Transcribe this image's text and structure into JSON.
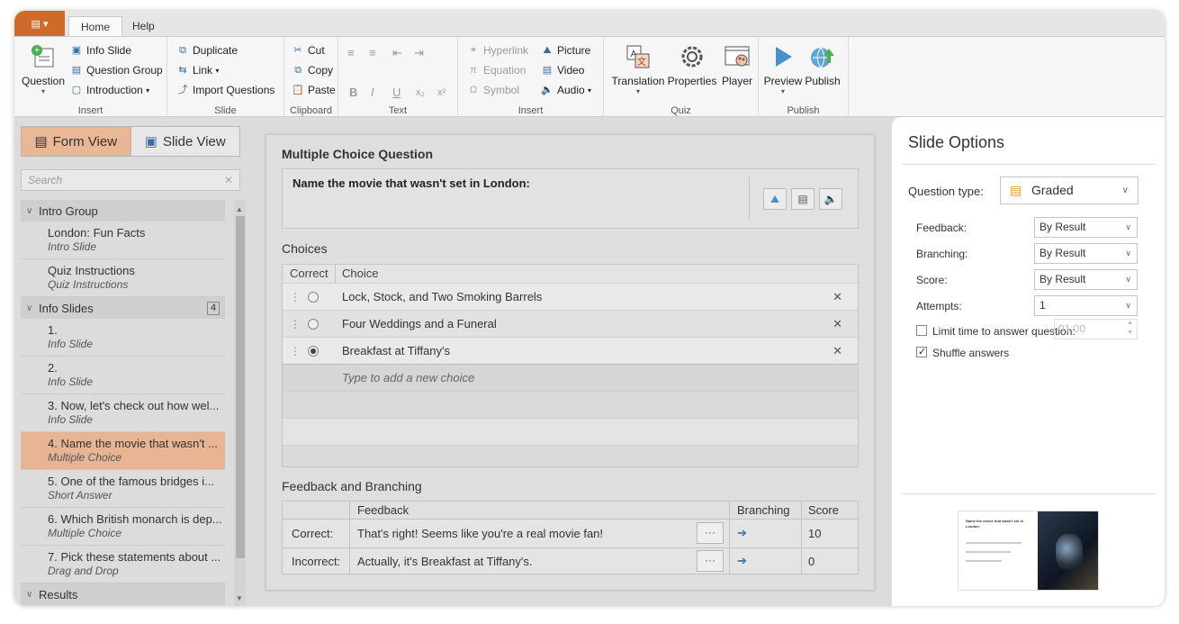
{
  "ribbon": {
    "tabs": [
      "Home",
      "Help"
    ],
    "groups": {
      "insert": {
        "label": "Insert",
        "question": "Question",
        "info_slide": "Info Slide",
        "question_group": "Question Group",
        "introduction": "Introduction"
      },
      "slide": {
        "label": "Slide",
        "duplicate": "Duplicate",
        "link": "Link",
        "import_questions": "Import Questions"
      },
      "clipboard": {
        "label": "Clipboard",
        "cut": "Cut",
        "copy": "Copy",
        "paste": "Paste"
      },
      "text": {
        "label": "Text",
        "bold": "B",
        "italic": "I",
        "underline": "U",
        "subscript": "x₂",
        "superscript": "x²"
      },
      "insert2": {
        "label": "Insert",
        "hyperlink": "Hyperlink",
        "equation": "Equation",
        "symbol": "Symbol",
        "picture": "Picture",
        "video": "Video",
        "audio": "Audio"
      },
      "quiz": {
        "label": "Quiz",
        "translation": "Translation",
        "properties": "Properties",
        "player": "Player"
      },
      "publish": {
        "label": "Publish",
        "preview": "Preview",
        "publish": "Publish"
      }
    }
  },
  "left": {
    "form_view": "Form View",
    "slide_view": "Slide View",
    "search_placeholder": "Search",
    "groups": [
      {
        "name": "Intro Group",
        "items": [
          {
            "title": "London: Fun Facts",
            "sub": "Intro Slide"
          },
          {
            "title": "Quiz Instructions",
            "sub": "Quiz Instructions"
          }
        ]
      },
      {
        "name": "Info Slides",
        "count": "4",
        "items": [
          {
            "title": "1.",
            "sub": "Info Slide"
          },
          {
            "title": "2.",
            "sub": "Info Slide"
          },
          {
            "title": "3. Now, let's check out how wel...",
            "sub": "Info Slide"
          },
          {
            "title": "4. Name the movie that wasn't ...",
            "sub": "Multiple Choice",
            "selected": true
          },
          {
            "title": "5. One of the famous bridges i...",
            "sub": "Short Answer"
          },
          {
            "title": "6. Which British monarch is dep...",
            "sub": "Multiple Choice"
          },
          {
            "title": "7. Pick these statements about ...",
            "sub": "Drag and Drop"
          }
        ]
      },
      {
        "name": "Results"
      }
    ]
  },
  "center": {
    "question_header": "Multiple Choice Question",
    "question_text": "Name the movie that wasn't set in London:",
    "choices_header": "Choices",
    "col_correct": "Correct",
    "col_choice": "Choice",
    "choices": [
      {
        "text": "Lock, Stock, and Two Smoking Barrels",
        "correct": false
      },
      {
        "text": "Four Weddings and a Funeral",
        "correct": false
      },
      {
        "text": "Breakfast at Tiffany's",
        "correct": true
      }
    ],
    "new_choice_placeholder": "Type to add a new choice",
    "feedback_header": "Feedback and Branching",
    "fb_col_feedback": "Feedback",
    "fb_col_branching": "Branching",
    "fb_col_score": "Score",
    "feedback": [
      {
        "label": "Correct:",
        "text": "That's right! Seems like you're a real movie fan!",
        "score": "10"
      },
      {
        "label": "Incorrect:",
        "text": "Actually, it's Breakfast at Tiffany's.",
        "score": "0"
      }
    ],
    "dots": "···",
    "branch_arrow": "➔"
  },
  "right": {
    "title": "Slide Options",
    "question_type_label": "Question type:",
    "question_type": "Graded",
    "feedback_label": "Feedback:",
    "feedback_value": "By Result",
    "branching_label": "Branching:",
    "branching_value": "By Result",
    "score_label": "Score:",
    "score_value": "By Result",
    "attempts_label": "Attempts:",
    "attempts_value": "1",
    "limit_time_label": "Limit time to answer question:",
    "limit_time_value": "01:00",
    "shuffle_label": "Shuffle answers",
    "thumbnail_title": "Name the movie that wasn't set in London:"
  }
}
